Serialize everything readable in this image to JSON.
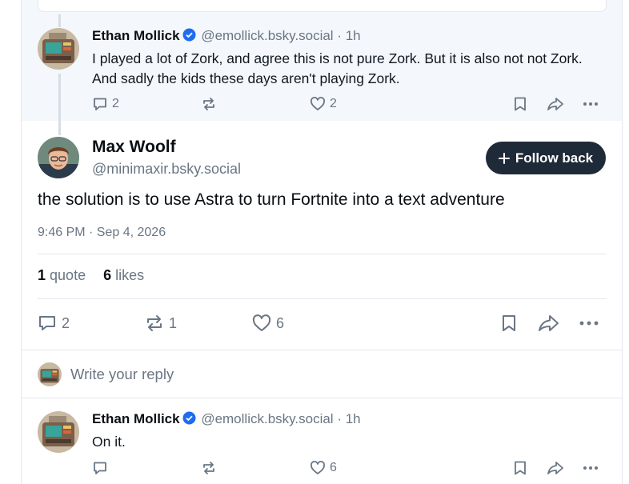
{
  "parent_post": {
    "author_name": "Ethan Mollick",
    "author_handle": "@emollick.bsky.social",
    "separator": "·",
    "age": "1h",
    "text": "I played a lot of Zork, and agree this is not pure Zork. But it is also not not Zork. And sadly the kids these days aren't playing Zork.",
    "reply_count": "2",
    "repost_count": "",
    "like_count": "2"
  },
  "focused_post": {
    "author_name": "Max Woolf",
    "author_handle": "@minimaxir.bsky.social",
    "follow_label": "Follow back",
    "text": "the solution is to use Astra to turn Fortnite into a text adventure",
    "timestamp": "9:46 PM · Sep 4, 2026",
    "quote_count": "1",
    "quote_label": "quote",
    "like_count": "6",
    "like_label": "likes",
    "reply_count": "2",
    "repost_count": "1",
    "like_action_count": "6"
  },
  "reply_composer": {
    "placeholder": "Write your reply"
  },
  "child_post": {
    "author_name": "Ethan Mollick",
    "author_handle": "@emollick.bsky.social",
    "separator": "·",
    "age": "1h",
    "text": "On it.",
    "reply_count": "",
    "repost_count": "",
    "like_count": "6"
  },
  "colors": {
    "accent_verified": "#1d6cf2",
    "button_dark": "#1f2a38",
    "muted_text": "#6a7684"
  }
}
